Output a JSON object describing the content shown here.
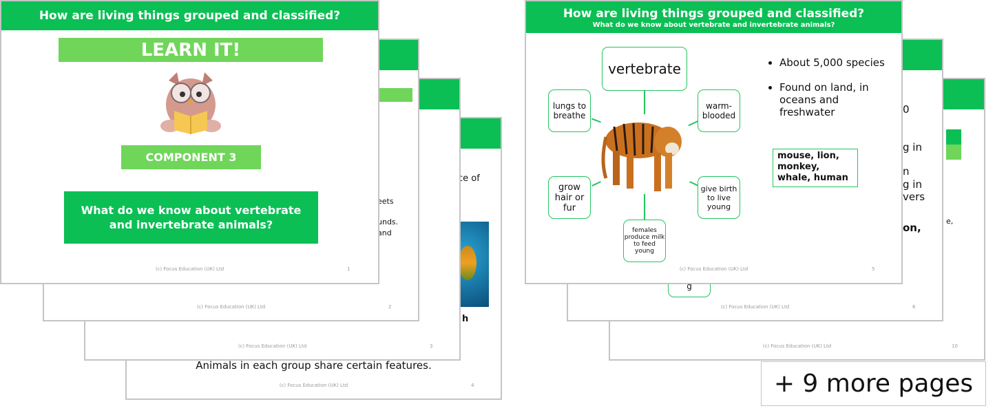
{
  "colors": {
    "header_green": "#0bbf55",
    "light_green": "#6fd65a"
  },
  "common": {
    "title": "How are living things grouped and classified?",
    "footer": "(c) Focus Education (UK) Ltd"
  },
  "slide1": {
    "learn": "LEARN IT!",
    "component": "COMPONENT 3",
    "question": "What do we know about vertebrate and invertebrate animals?",
    "num": "1",
    "icon": "owl-reading-icon"
  },
  "slide2": {
    "num": "2",
    "frags": [
      "eets",
      "unds.",
      "and"
    ]
  },
  "slide3": {
    "num": "3"
  },
  "slide4": {
    "num": "4",
    "frags": [
      "ce of",
      "h"
    ],
    "bottom": "Animals in each group share certain features.",
    "image": "clownfish-coral-image"
  },
  "slide5": {
    "subtitle": "What do we know about vertebrate and invertebrate animals?",
    "num": "5",
    "center": "vertebrate",
    "nodes": [
      "lungs to breathe",
      "warm-blooded",
      "grow hair or fur",
      "give birth to live young",
      "females produce milk to feed young"
    ],
    "bullets": [
      "About 5,000 species",
      "Found on land, in oceans and freshwater"
    ],
    "examples": "mouse, lion, monkey, whale, human",
    "image": "tiger-image"
  },
  "slide6": {
    "num": "6",
    "frags": [
      "0",
      "g in",
      "n",
      "g in",
      "vers",
      "on,",
      "g"
    ]
  },
  "slide10": {
    "num": "10",
    "frags": [
      "e,"
    ]
  },
  "more": "+ 9 more pages"
}
